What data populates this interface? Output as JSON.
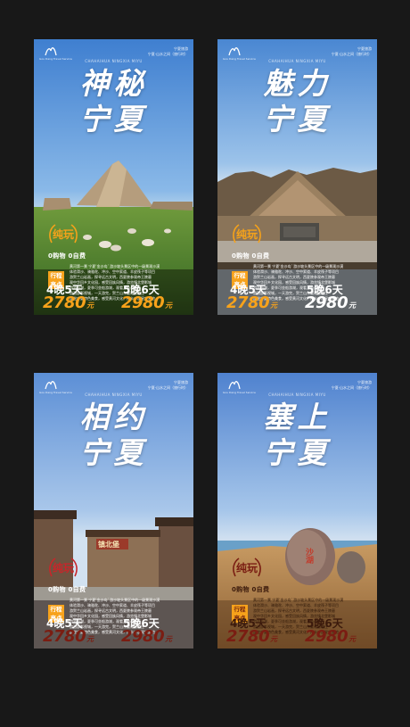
{
  "posters": [
    {
      "logo_sub": "Gou Dang Travel Service",
      "brand_lines": [
        "宁夏旅游",
        "宁夏·山水之间（旅行时）"
      ],
      "subtitle": "CHAHAIHUA NINGXIA MIYU",
      "title_line1": "神秘",
      "title_line2": "宁夏",
      "badge": "纯玩",
      "no_shop": "0购物 0自费",
      "highlight": [
        "行程",
        "亮点"
      ],
      "desc_lines": [
        "黄河第一景 宁夏‘金沙岛’ 游沙坡头景区中的一级景观沙漠",
        "体验滑沙、骑骆驼、冲沙、空中索道、羊皮筏子等项目",
        "游贺兰山岩画，探寻远古文明，西夏陵参观帝王陵墓",
        "观中华回乡文化园，感受回族风情，游览镇北堡影城",
        "游览沙湖，夏季可坐船游湖，观看万亩芦苇荡",
        "游西部影视城，一天游完，贺兰山东麓葡萄酒庄",
        "品尝宁夏特色美食，感受黄河文化，打卡沙漠星空营地"
      ],
      "offer1_nights": "4晚5天",
      "offer1_price": "2780",
      "offer2_nights": "5晚6天",
      "offer2_price": "2980",
      "yen": "元"
    },
    {
      "logo_sub": "Gou Dang Travel Service",
      "brand_lines": [
        "宁夏旅游",
        "宁夏·山水之间（旅行时）"
      ],
      "subtitle": "CHAHAIHUA NINGXIA MIYU",
      "title_line1": "魅力",
      "title_line2": "宁夏",
      "badge": "纯玩",
      "no_shop": "0购物 0自费",
      "highlight": [
        "行程",
        "亮点"
      ],
      "desc_lines": [
        "黄河第一景 宁夏‘金沙岛’ 游沙坡头景区中的一级景观沙漠",
        "体验滑沙、骑骆驼、冲沙、空中索道、羊皮筏子等项目",
        "游贺兰山岩画，探寻远古文明，西夏陵参观帝王陵墓",
        "观中华回乡文化园，感受回族风情，游览镇北堡影城",
        "游览沙湖，夏季可坐船游湖，观看万亩芦苇荡",
        "游西部影视城，一天游完，贺兰山东麓葡萄酒庄",
        "品尝宁夏特色美食，感受黄河文化，打卡沙漠星空营地"
      ],
      "offer1_nights": "4晚5天",
      "offer1_price": "2780",
      "offer2_nights": "5晚6天",
      "offer2_price": "2980",
      "yen": "元"
    },
    {
      "logo_sub": "Gou Dang Travel Service",
      "brand_lines": [
        "宁夏旅游",
        "宁夏·山水之间（旅行时）"
      ],
      "subtitle": "CHAHAIHUA NINGXIA MIYU",
      "title_line1": "相约",
      "title_line2": "宁夏",
      "badge": "纯玩",
      "no_shop": "0购物 0自费",
      "highlight": [
        "行程",
        "亮点"
      ],
      "desc_lines": [
        "黄河第一景 宁夏‘金沙岛’ 游沙坡头景区中的一级景观沙漠",
        "体验滑沙、骑骆驼、冲沙、空中索道、羊皮筏子等项目",
        "游贺兰山岩画，探寻远古文明，西夏陵参观帝王陵墓",
        "观中华回乡文化园，感受回族风情，游览镇北堡影城",
        "游览沙湖，夏季可坐船游湖，观看万亩芦苇荡",
        "游西部影视城，一天游完，贺兰山东麓葡萄酒庄",
        "品尝宁夏特色美食，感受黄河文化，打卡沙漠星空营地"
      ],
      "offer1_nights": "4晚5天",
      "offer1_price": "2780",
      "offer2_nights": "5晚6天",
      "offer2_price": "2980",
      "yen": "元",
      "sign": "镇北堡"
    },
    {
      "logo_sub": "Gou Dang Travel Service",
      "brand_lines": [
        "宁夏旅游",
        "宁夏·山水之间（旅行时）"
      ],
      "subtitle": "CHAHAIHUA NINGXIA MIYU",
      "title_line1": "塞上",
      "title_line2": "宁夏",
      "badge": "纯玩",
      "no_shop": "0购物 0自费",
      "highlight": [
        "行程",
        "亮点"
      ],
      "desc_lines": [
        "黄河第一景 宁夏‘金沙岛’ 游沙坡头景区中的一级景观沙漠",
        "体验滑沙、骑骆驼、冲沙、空中索道、羊皮筏子等项目",
        "游贺兰山岩画，探寻远古文明，西夏陵参观帝王陵墓",
        "观中华回乡文化园，感受回族风情，游览镇北堡影城",
        "游览沙湖，夏季可坐船游湖，观看万亩芦苇荡",
        "游西部影视城，一天游完，贺兰山东麓葡萄酒庄",
        "品尝宁夏特色美食，感受黄河文化，打卡沙漠星空营地"
      ],
      "offer1_nights": "4晚5天",
      "offer1_price": "2780",
      "offer2_nights": "5晚6天",
      "offer2_price": "2980",
      "yen": "元",
      "rock_text": "沙湖"
    }
  ],
  "colors": {
    "orange": "#f7a21b",
    "dark_red": "#7a1d12",
    "white": "#ffffff"
  }
}
